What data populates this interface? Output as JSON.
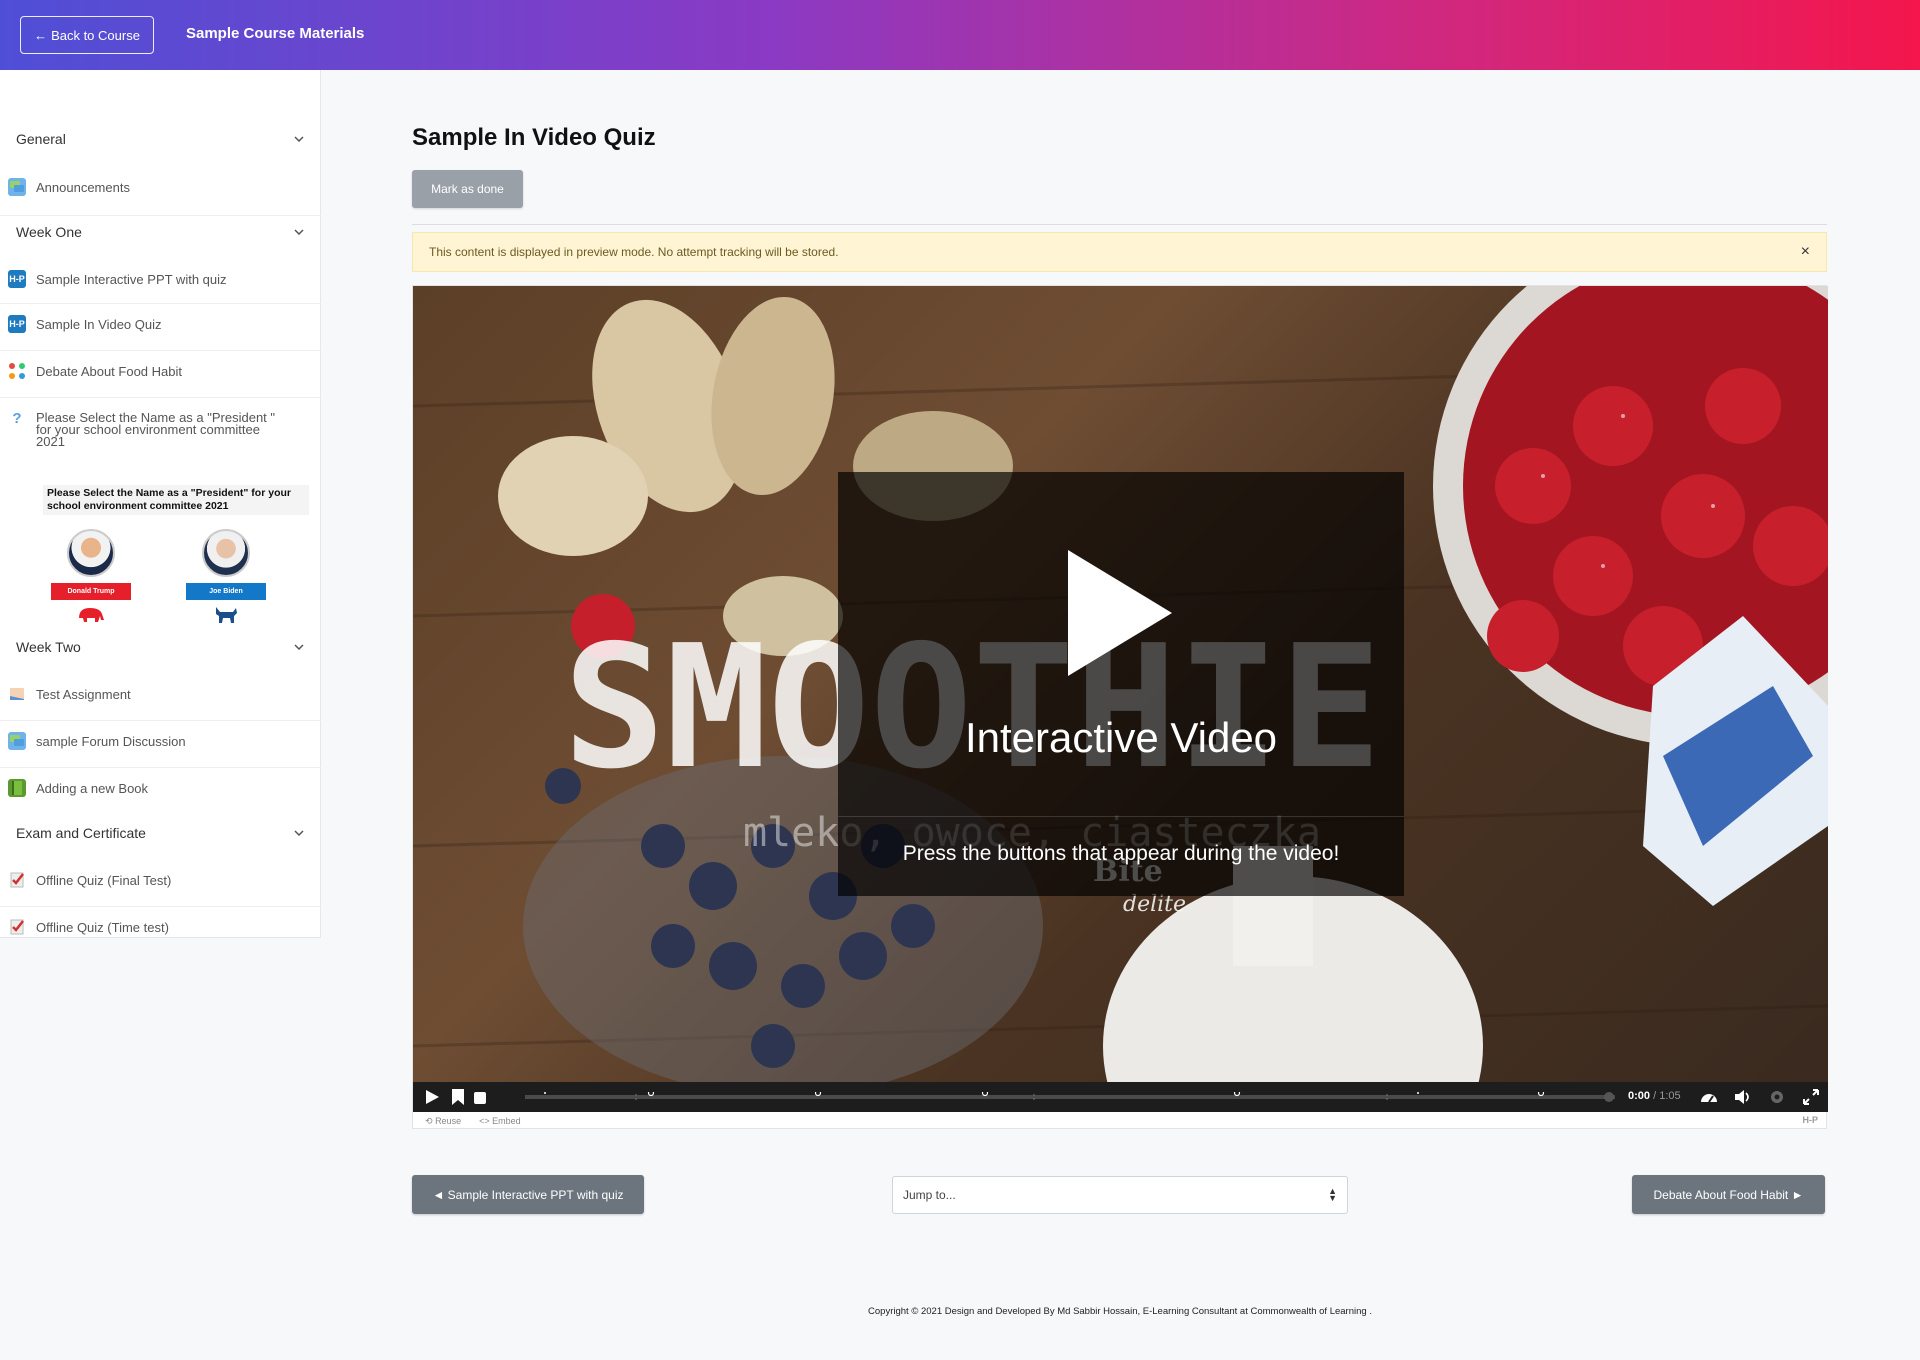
{
  "header": {
    "back_label": "Back to Course",
    "course_title": "Sample Course Materials",
    "gradient_start": "#4f4fd6",
    "gradient_end": "#f4164c"
  },
  "sidebar": {
    "sections": [
      {
        "title": "General"
      },
      {
        "title": "Week One"
      },
      {
        "title": "Week Two"
      },
      {
        "title": "Exam and Certificate"
      }
    ],
    "items": [
      {
        "label": "Announcements",
        "icon": "forum-icon"
      },
      {
        "label": "Sample Interactive PPT with quiz",
        "icon": "h5p-icon"
      },
      {
        "label": "Sample In Video Quiz",
        "icon": "h5p-icon"
      },
      {
        "label": "Debate About Food Habit",
        "icon": "workshop-icon"
      },
      {
        "label": "Please Select the Name as a \"President \" for your school environment committee 2021",
        "icon": "question-icon"
      },
      {
        "label": "Test Assignment",
        "icon": "assignment-icon"
      },
      {
        "label": "sample Forum Discussion",
        "icon": "forum-icon"
      },
      {
        "label": "Adding a new Book",
        "icon": "book-icon"
      },
      {
        "label": "Offline Quiz (Final Test)",
        "icon": "quiz-icon"
      },
      {
        "label": "Offline Quiz (Time test)",
        "icon": "quiz-icon"
      }
    ],
    "poll": {
      "question": "Please Select the Name as a \"President\" for your school environment committee 2021",
      "candidates": [
        {
          "name": "Donald Trump",
          "color": "#e5202b"
        },
        {
          "name": "Joe Biden",
          "color": "#1478c8"
        }
      ]
    }
  },
  "main": {
    "title": "Sample In Video Quiz",
    "mark_done": "Mark as done",
    "notice": "This content is displayed in preview mode. No attempt tracking will be stored.",
    "notice_close": "×",
    "video": {
      "splash_title": "Interactive Video",
      "splash_subtitle": "Press the buttons that appear during the video!",
      "time_current": "0:00",
      "time_total": "/ 1:05",
      "reuse": "Reuse",
      "embed": "Embed",
      "brand": "H-P"
    },
    "nav": {
      "prev": "◄ Sample Interactive PPT with quiz",
      "next": "Debate About Food Habit ►",
      "jump_placeholder": "Jump to..."
    }
  },
  "footer": {
    "copyright": "Copyright © 2021 Design and Developed By Md Sabbir Hossain, E-Learning Consultant at Commonwealth of Learning ."
  }
}
